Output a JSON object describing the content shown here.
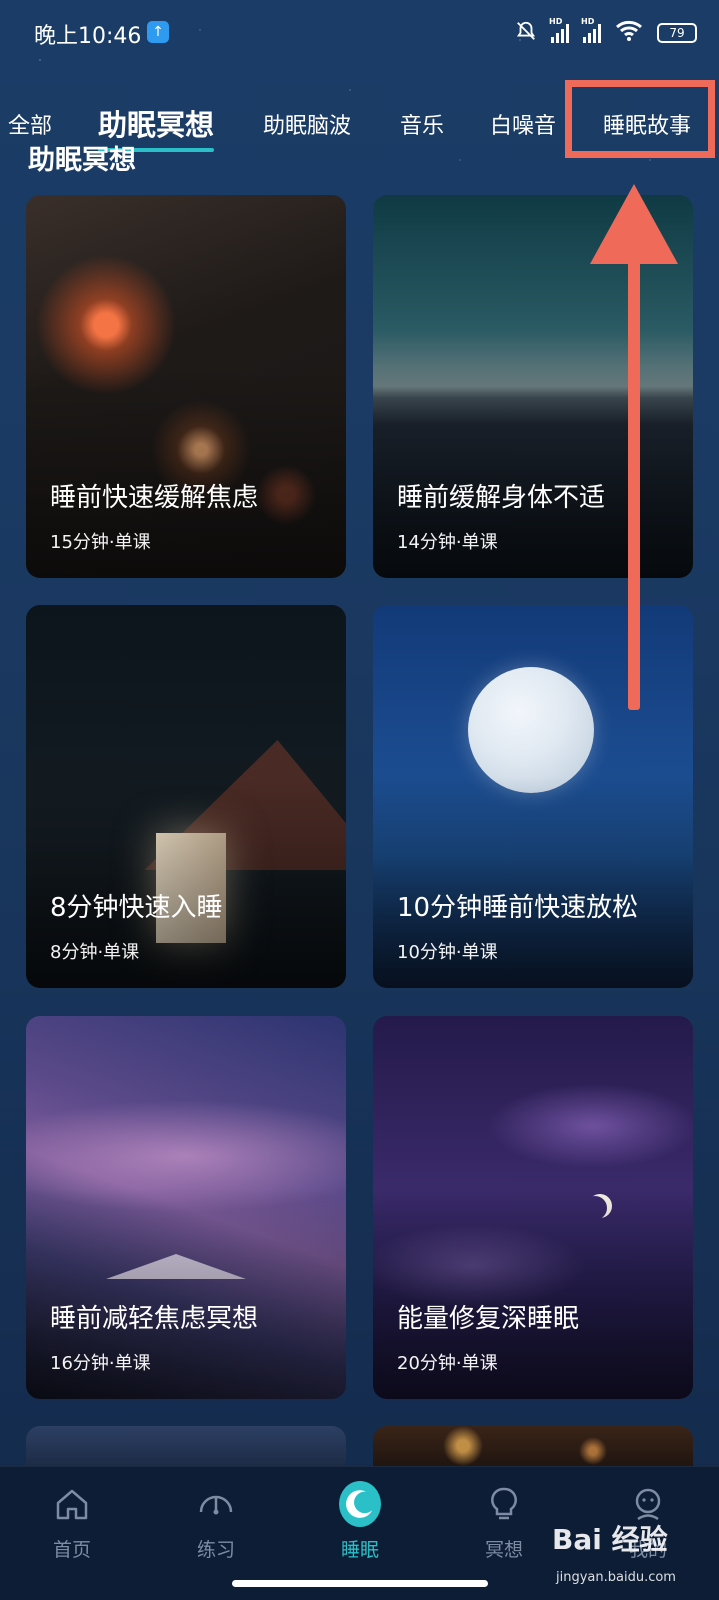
{
  "status": {
    "time": "晚上10:46",
    "battery": "79",
    "hd1": "HD",
    "hd2": "HD"
  },
  "tabs": [
    {
      "label": "全部"
    },
    {
      "label": "助眠冥想",
      "active": true
    },
    {
      "label": "助眠脑波"
    },
    {
      "label": "音乐"
    },
    {
      "label": "白噪音"
    },
    {
      "label": "睡眠故事"
    }
  ],
  "section_title": "助眠冥想",
  "cards": [
    {
      "title": "睡前快速缓解焦虑",
      "meta": "15分钟·单课"
    },
    {
      "title": "睡前缓解身体不适",
      "meta": "14分钟·单课"
    },
    {
      "title": "8分钟快速入睡",
      "meta": "8分钟·单课"
    },
    {
      "title": "10分钟睡前快速放松",
      "meta": "10分钟·单课"
    },
    {
      "title": "睡前减轻焦虑冥想",
      "meta": "16分钟·单课"
    },
    {
      "title": "能量修复深睡眠",
      "meta": "20分钟·单课"
    }
  ],
  "bottom_nav": [
    {
      "label": "首页",
      "icon": "home-icon"
    },
    {
      "label": "练习",
      "icon": "gauge-icon"
    },
    {
      "label": "睡眠",
      "icon": "moon-icon",
      "active": true
    },
    {
      "label": "冥想",
      "icon": "lightbulb-icon"
    },
    {
      "label": "我的",
      "icon": "profile-icon"
    }
  ],
  "watermark": {
    "brand": "Bai 经验",
    "url": "jingyan.baidu.com"
  },
  "colors": {
    "accent": "#2bbfc7",
    "annotation": "#f06a5a"
  }
}
